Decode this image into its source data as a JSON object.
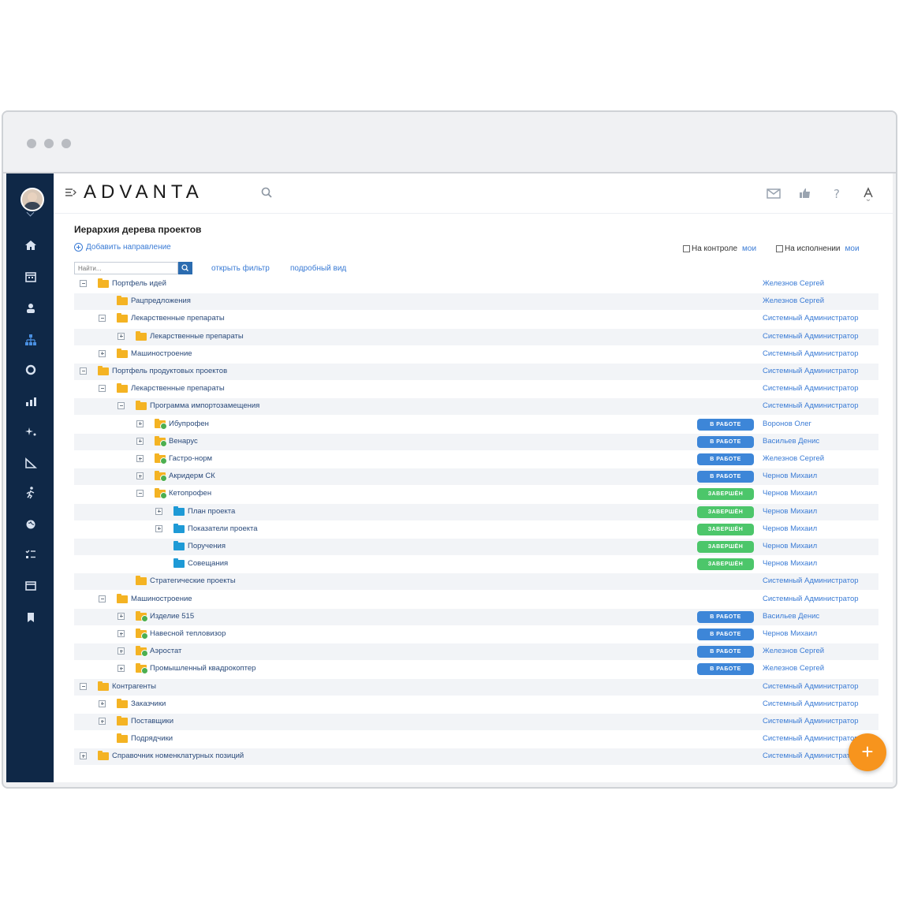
{
  "app": {
    "logo_text": "ADVANTA",
    "accent_color": "#3a7bd5",
    "sidebar_color": "#0f2847",
    "fab_color": "#f7941d"
  },
  "sidebar": {
    "icons": [
      "home-icon",
      "calendar-icon",
      "users-icon",
      "hierarchy-icon",
      "circle-icon",
      "chart-icon",
      "sparkle-icon",
      "ruler-icon",
      "runner-icon",
      "globe-icon",
      "checklist-icon",
      "window-icon",
      "bookmark-icon"
    ]
  },
  "topbar": {
    "icons": [
      "menu-icon",
      "search-icon",
      "mail-icon",
      "like-icon",
      "help-icon",
      "text-size-icon"
    ]
  },
  "panel": {
    "title": "Иерархия дерева проектов",
    "add_label": "Добавить направление",
    "search_placeholder": "Найти...",
    "open_filter_label": "открыть фильтр",
    "detailed_view_label": "подробный вид",
    "on_control_label": "На контроле",
    "on_control_mine": "мои",
    "on_execution_label": "На исполнении",
    "on_execution_mine": "мои"
  },
  "tree": [
    {
      "level": 0,
      "toggle": "minus",
      "folder": "yellow",
      "name": "Портфель идей",
      "status": "",
      "owner": "Железнов Сергей"
    },
    {
      "level": 1,
      "toggle": "",
      "folder": "yellow",
      "name": "Рацпредложения",
      "status": "",
      "owner": "Железнов Сергей"
    },
    {
      "level": 1,
      "toggle": "minus",
      "folder": "yellow",
      "name": "Лекарственные препараты",
      "status": "",
      "owner": "Системный Администратор"
    },
    {
      "level": 2,
      "toggle": "plus",
      "folder": "yellow",
      "name": "Лекарственные препараты",
      "status": "",
      "owner": "Системный Администратор"
    },
    {
      "level": 1,
      "toggle": "plus",
      "folder": "yellow",
      "name": "Машиностроение",
      "status": "",
      "owner": "Системный Администратор"
    },
    {
      "level": 0,
      "toggle": "minus",
      "folder": "yellow",
      "name": "Портфель продуктовых проектов",
      "status": "",
      "owner": "Системный Администратор"
    },
    {
      "level": 1,
      "toggle": "minus",
      "folder": "yellow",
      "name": "Лекарственные препараты",
      "status": "",
      "owner": "Системный Администратор"
    },
    {
      "level": 2,
      "toggle": "minus",
      "folder": "yellow",
      "name": "Программа импортозамещения",
      "status": "",
      "owner": "Системный Администратор"
    },
    {
      "level": 3,
      "toggle": "plus",
      "folder": "proj",
      "name": "Ибупрофен",
      "status": "В РАБОТЕ",
      "owner": "Воронов Олег"
    },
    {
      "level": 3,
      "toggle": "plus",
      "folder": "proj",
      "name": "Венарус",
      "status": "В РАБОТЕ",
      "owner": "Васильев Денис"
    },
    {
      "level": 3,
      "toggle": "plus",
      "folder": "proj",
      "name": "Гастро-норм",
      "status": "В РАБОТЕ",
      "owner": "Железнов Сергей"
    },
    {
      "level": 3,
      "toggle": "plus",
      "folder": "proj",
      "name": "Акридерм СК",
      "status": "В РАБОТЕ",
      "owner": "Чернов Михаил"
    },
    {
      "level": 3,
      "toggle": "minus",
      "folder": "proj",
      "name": "Кетопрофен",
      "status": "ЗАВЕРШЁН",
      "owner": "Чернов Михаил"
    },
    {
      "level": 4,
      "toggle": "plus",
      "folder": "blue",
      "name": "План проекта",
      "status": "ЗАВЕРШЁН",
      "owner": "Чернов Михаил"
    },
    {
      "level": 4,
      "toggle": "plus",
      "folder": "blue",
      "name": "Показатели проекта",
      "status": "ЗАВЕРШЁН",
      "owner": "Чернов Михаил"
    },
    {
      "level": 4,
      "toggle": "",
      "folder": "blue",
      "name": "Поручения",
      "status": "ЗАВЕРШЁН",
      "owner": "Чернов Михаил"
    },
    {
      "level": 4,
      "toggle": "",
      "folder": "blue",
      "name": "Совещания",
      "status": "ЗАВЕРШЁН",
      "owner": "Чернов Михаил"
    },
    {
      "level": 2,
      "toggle": "",
      "folder": "yellow",
      "name": "Стратегические проекты",
      "status": "",
      "owner": "Системный Администратор"
    },
    {
      "level": 1,
      "toggle": "minus",
      "folder": "yellow",
      "name": "Машиностроение",
      "status": "",
      "owner": "Системный Администратор"
    },
    {
      "level": 2,
      "toggle": "plus",
      "folder": "proj",
      "name": "Изделие 515",
      "status": "В РАБОТЕ",
      "owner": "Васильев Денис"
    },
    {
      "level": 2,
      "toggle": "plus",
      "folder": "proj",
      "name": "Навесной тепловизор",
      "status": "В РАБОТЕ",
      "owner": "Чернов Михаил"
    },
    {
      "level": 2,
      "toggle": "plus",
      "folder": "proj",
      "name": "Аэростат",
      "status": "В РАБОТЕ",
      "owner": "Железнов Сергей"
    },
    {
      "level": 2,
      "toggle": "plus",
      "folder": "proj",
      "name": "Промышленный квадрокоптер",
      "status": "В РАБОТЕ",
      "owner": "Железнов Сергей"
    },
    {
      "level": 0,
      "toggle": "minus",
      "folder": "yellow",
      "name": "Контрагенты",
      "status": "",
      "owner": "Системный Администратор"
    },
    {
      "level": 1,
      "toggle": "plus",
      "folder": "yellow",
      "name": "Заказчики",
      "status": "",
      "owner": "Системный Администратор"
    },
    {
      "level": 1,
      "toggle": "plus",
      "folder": "yellow",
      "name": "Поставщики",
      "status": "",
      "owner": "Системный Администратор"
    },
    {
      "level": 1,
      "toggle": "",
      "folder": "yellow",
      "name": "Подрядчики",
      "status": "",
      "owner": "Системный Администратор"
    },
    {
      "level": 0,
      "toggle": "plus",
      "folder": "yellow",
      "name": "Справочник номенклатурных позиций",
      "status": "",
      "owner": "Системный Администратор"
    }
  ],
  "fab": {
    "label": "+"
  }
}
